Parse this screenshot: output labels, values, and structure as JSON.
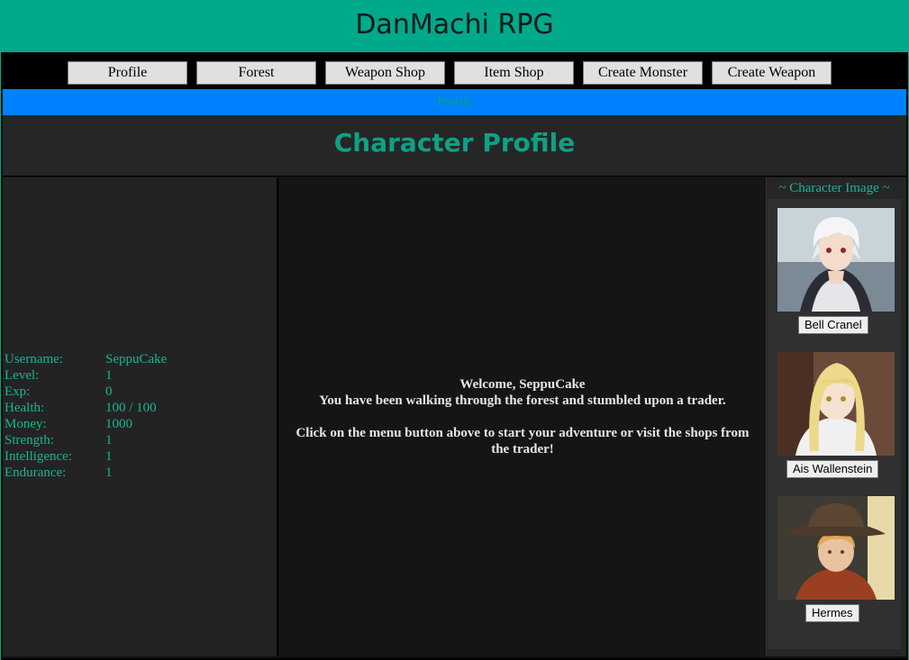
{
  "header": {
    "title": "DanMachi RPG"
  },
  "nav": {
    "items": [
      "Profile",
      "Forest",
      "Weapon Shop",
      "Item Shop",
      "Create Monster",
      "Create Weapon"
    ]
  },
  "status": {
    "text": "Profile"
  },
  "page": {
    "title": "Character Profile"
  },
  "stats": {
    "rows": [
      {
        "label": "Username:",
        "value": "SeppuCake"
      },
      {
        "label": "Level:",
        "value": "1"
      },
      {
        "label": "Exp:",
        "value": "0"
      },
      {
        "label": "Health:",
        "value": "100 / 100"
      },
      {
        "label": "Money:",
        "value": "1000"
      },
      {
        "label": "Strength:",
        "value": "1"
      },
      {
        "label": "Intelligence:",
        "value": "1"
      },
      {
        "label": "Endurance:",
        "value": "1"
      }
    ]
  },
  "welcome": {
    "line1": "Welcome, SeppuCake",
    "line2": "You have been walking through the forest and stumbled upon a trader.",
    "line3": "Click on the menu button above to start your adventure or visit the shops from the trader!"
  },
  "images": {
    "header": "~ Character Image ~",
    "characters": [
      "Bell Cranel",
      "Ais Wallenstein",
      "Hermes"
    ]
  }
}
